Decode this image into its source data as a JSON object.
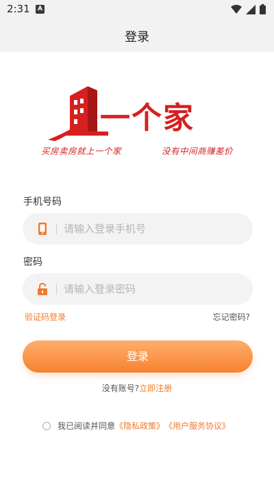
{
  "status_bar": {
    "time": "2:31",
    "notification_icon": "a-badge-icon",
    "icons": [
      "wifi-icon",
      "signal-icon",
      "battery-icon"
    ]
  },
  "header": {
    "title": "登录"
  },
  "logo": {
    "brand": "一个家",
    "slogan_left": "买房卖房就上一个家",
    "slogan_right": "没有中间商赚差价",
    "color": "#d62020"
  },
  "form": {
    "phone_label": "手机号码",
    "phone_placeholder": "请输入登录手机号",
    "password_label": "密码",
    "password_placeholder": "请输入登录密码",
    "sms_login": "验证码登录",
    "forgot_password": "忘记密码?",
    "login_button": "登录"
  },
  "register": {
    "prompt": "没有账号?",
    "link": "立即注册"
  },
  "agreement": {
    "prefix": "我已阅读并同意",
    "privacy_link": "《隐私政策》",
    "terms_link": "《用户服务协议》"
  },
  "colors": {
    "accent": "#f07a2e",
    "button_top": "#ffae6d",
    "button_bottom": "#f6822f",
    "input_bg": "#f3f3f3"
  }
}
